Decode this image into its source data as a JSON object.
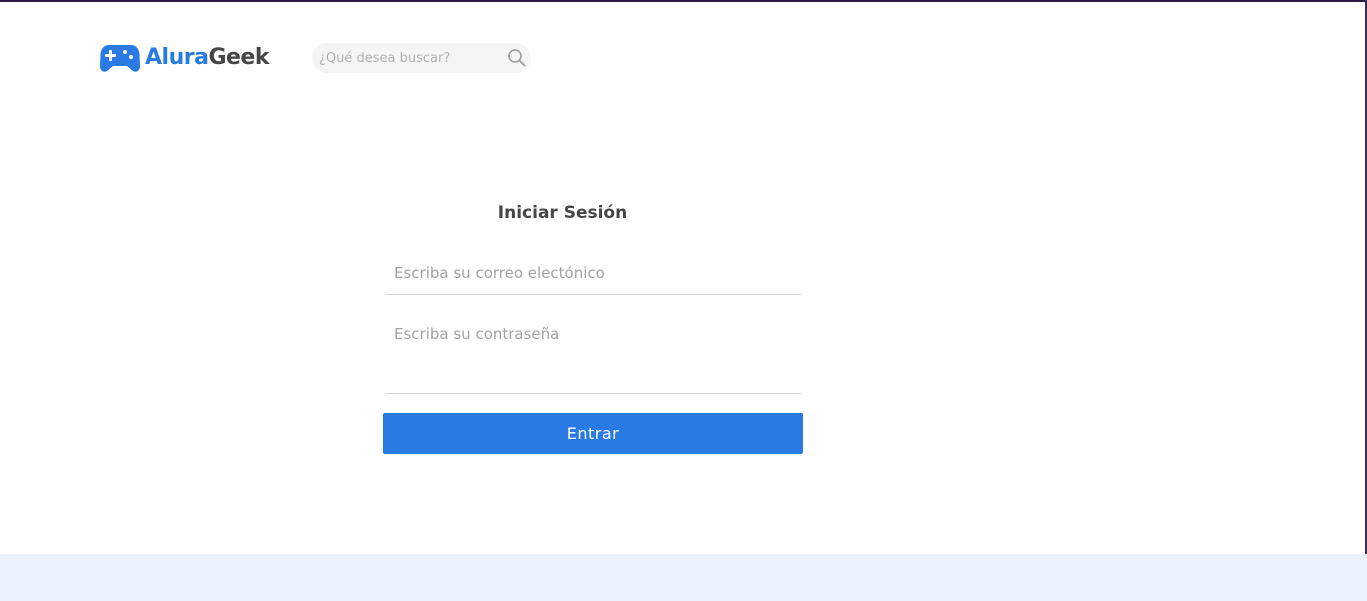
{
  "header": {
    "logo": {
      "icon": "gamepad-icon",
      "text_primary": "Alura",
      "text_secondary": "Geek"
    },
    "search": {
      "placeholder": "¿Qué desea buscar?",
      "value": "",
      "icon": "search-icon"
    }
  },
  "login": {
    "title": "Iniciar Sesión",
    "email": {
      "placeholder": "Escriba su correo electónico",
      "value": ""
    },
    "password": {
      "placeholder": "Escriba su contraseña",
      "value": ""
    },
    "submit_label": "Entrar"
  },
  "colors": {
    "accent": "#2a7ae4",
    "text": "#464646",
    "footer_background": "#eaf2fd",
    "search_background": "#f5f5f5"
  }
}
